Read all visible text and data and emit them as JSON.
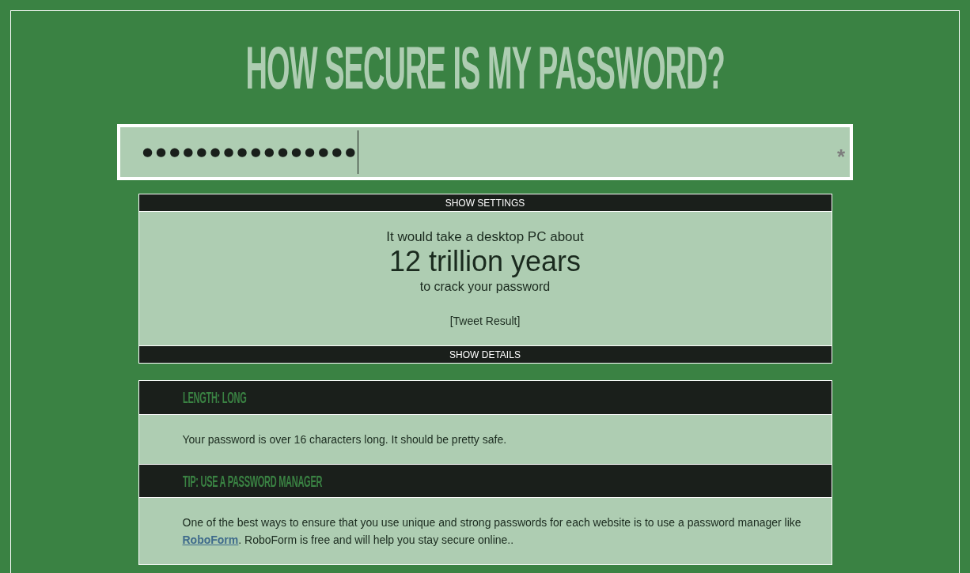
{
  "title": "HOW SECURE IS MY PASSWORD?",
  "password_field": {
    "value": "●●●●●●●●●●●●●●●●",
    "focused": true,
    "toggle": "*"
  },
  "settings_toggle": {
    "label": "SHOW SETTINGS"
  },
  "result": {
    "lead": "It would take a desktop PC about",
    "time": "12 trillion years",
    "tail": "to crack your password",
    "tweet_link": "[Tweet Result]"
  },
  "details_toggle": {
    "label": "SHOW DETAILS"
  },
  "checks": [
    {
      "heading": "LENGTH: LONG",
      "body": {
        "before": "Your password is over 16 characters long. It should be pretty safe."
      }
    },
    {
      "heading": "TIP: USE A PASSWORD MANAGER",
      "body": {
        "before": "One of the best ways to ensure that you use unique and strong passwords for each website is to use a password manager like ",
        "link": "RoboForm",
        "after": ". RoboForm is free and will help you stay secure online.."
      }
    }
  ]
}
